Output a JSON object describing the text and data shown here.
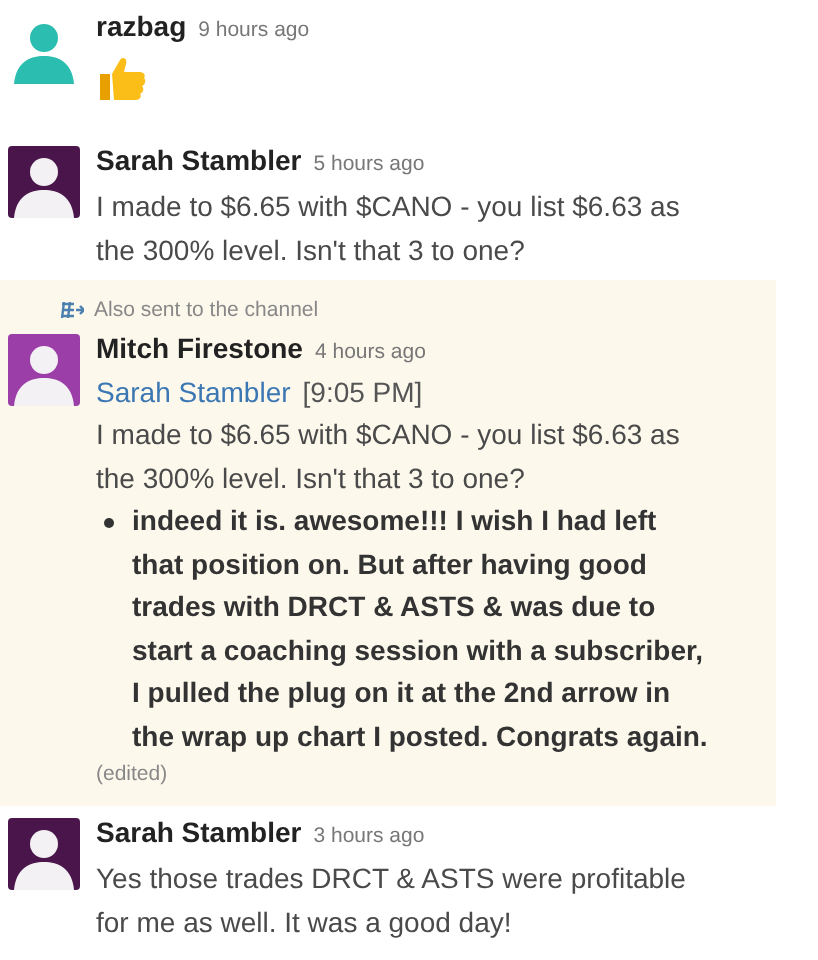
{
  "messages": [
    {
      "author": "razbag",
      "time": "9 hours ago",
      "color": "#2bbdaf",
      "highlighted": false,
      "body": [
        {
          "kind": "thumbs_up"
        }
      ]
    },
    {
      "author": "Sarah Stambler",
      "time": "5 hours ago",
      "color": "#4a154b",
      "highlighted": false,
      "body": [
        {
          "kind": "text",
          "text": "I made to $6.65 with $CANO - you list $6.63 as the 300% level.  Isn't that 3 to one?"
        }
      ]
    },
    {
      "author": "Mitch Firestone",
      "time": "4 hours ago",
      "color": "#9c3ea8",
      "highlighted": true,
      "note": "Also sent to the channel",
      "body": [
        {
          "kind": "quote_author",
          "text": "Sarah Stambler",
          "stamp": "[9:05 PM]"
        },
        {
          "kind": "text",
          "text": "I made to $6.65 with $CANO - you list $6.63 as the 300% level.  Isn't that 3 to one?"
        },
        {
          "kind": "bullet",
          "text": "indeed it is. awesome!!!  I wish I had left that position on. But after having good trades with DRCT &  ASTS & was due to start a coaching session with a subscriber, I pulled the plug on it at the 2nd arrow in the wrap up chart I posted.  Congrats again."
        },
        {
          "kind": "edited",
          "text": "(edited)"
        }
      ]
    },
    {
      "author": "Sarah Stambler",
      "time": "3 hours ago",
      "color": "#4a154b",
      "highlighted": false,
      "body": [
        {
          "kind": "text",
          "text": "Yes those trades DRCT & ASTS were profitable for me as well.  It was a good day!"
        }
      ]
    }
  ]
}
